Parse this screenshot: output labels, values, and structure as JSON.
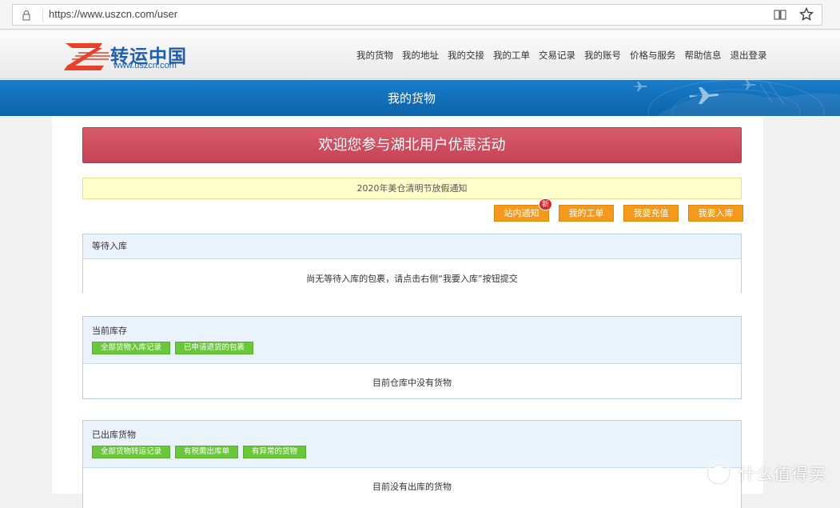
{
  "browser": {
    "url": "https://www.uszcn.com/user"
  },
  "site": {
    "logo_text": "转运中国",
    "logo_sub": "www.uszcn.com",
    "nav": [
      "我的货物",
      "我的地址",
      "我的交接",
      "我的工单",
      "交易记录",
      "我的账号",
      "价格与服务",
      "帮助信息",
      "退出登录"
    ]
  },
  "banner": {
    "title": "我的货物"
  },
  "promo": {
    "text": "欢迎您参与湖北用户优惠活动"
  },
  "notice": {
    "text": "2020年美仓清明节放假通知"
  },
  "actions": {
    "site_notice": "站内通知",
    "new_badge": "新",
    "my_tickets": "我的工单",
    "recharge": "我要充值",
    "inbound": "我要入库"
  },
  "panels": {
    "waiting": {
      "title": "等待入库",
      "empty": "尚无等待入库的包裹，请点击右侧“我要入库”按钮提交"
    },
    "stock": {
      "title": "当前库存",
      "buttons": [
        "全部货物入库记录",
        "已申请退货的包裹"
      ],
      "empty": "目前仓库中没有货物"
    },
    "shipped": {
      "title": "已出库货物",
      "buttons": [
        "全部货物转运记录",
        "有税需出库单",
        "有异常的货物"
      ],
      "empty": "目前没有出库的货物"
    }
  },
  "watermark": {
    "text": "什么值得买"
  },
  "colors": {
    "banner_blue": "#1170bb",
    "promo_red": "#cf4f60",
    "action_orange": "#f39a1d",
    "panel_green": "#6ac63b"
  }
}
